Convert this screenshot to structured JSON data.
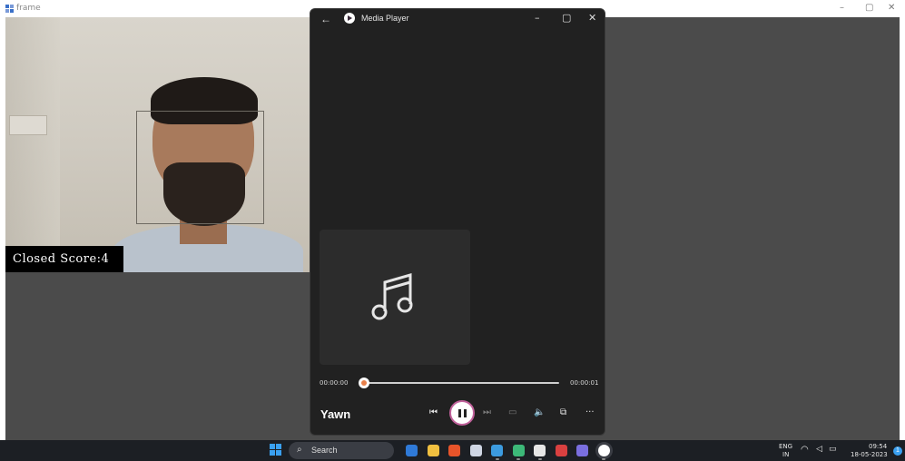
{
  "frame_window": {
    "title": "frame",
    "controls": {
      "minimize": "–",
      "maximize": "▢",
      "close": "✕"
    },
    "overlay_text": "Closed Score:4"
  },
  "media_player": {
    "title": "Media Player",
    "back_glyph": "←",
    "controls": {
      "minimize": "–",
      "maximize": "▢",
      "close": "✕"
    },
    "current_time": "00:00:00",
    "total_time": "00:00:01",
    "progress": 0.0,
    "song_title": "Yawn",
    "buttons": {
      "previous": "⏮",
      "next": "⏭",
      "captions": "▭",
      "volume": "🔈",
      "miniplayer": "⧉",
      "more": "···"
    }
  },
  "taskbar": {
    "search_placeholder": "Search",
    "search_glyph": "⌕",
    "apps": [
      {
        "name": "copilot",
        "color": "#2f7ad8"
      },
      {
        "name": "file-explorer",
        "color": "#f0c040"
      },
      {
        "name": "brave",
        "color": "#e8542a"
      },
      {
        "name": "edge-like",
        "color": "#cfd6e4"
      },
      {
        "name": "photos",
        "color": "#3c9be0"
      },
      {
        "name": "circle-app",
        "color": "#3cb878"
      },
      {
        "name": "terminal",
        "color": "#e6e6e6"
      },
      {
        "name": "red-app",
        "color": "#d94040"
      },
      {
        "name": "pen-app",
        "color": "#7a6fe0"
      },
      {
        "name": "media-player",
        "color": "#ffffff"
      }
    ],
    "tray": {
      "language": "ENG",
      "region": "IN",
      "time": "09:54",
      "date": "18-05-2023",
      "notification_count": "1"
    }
  },
  "colors": {
    "accent_progress": "#e8804a",
    "play_ring": "#c0609a",
    "desktop": "#4b4b4b",
    "player_bg": "#212121"
  }
}
